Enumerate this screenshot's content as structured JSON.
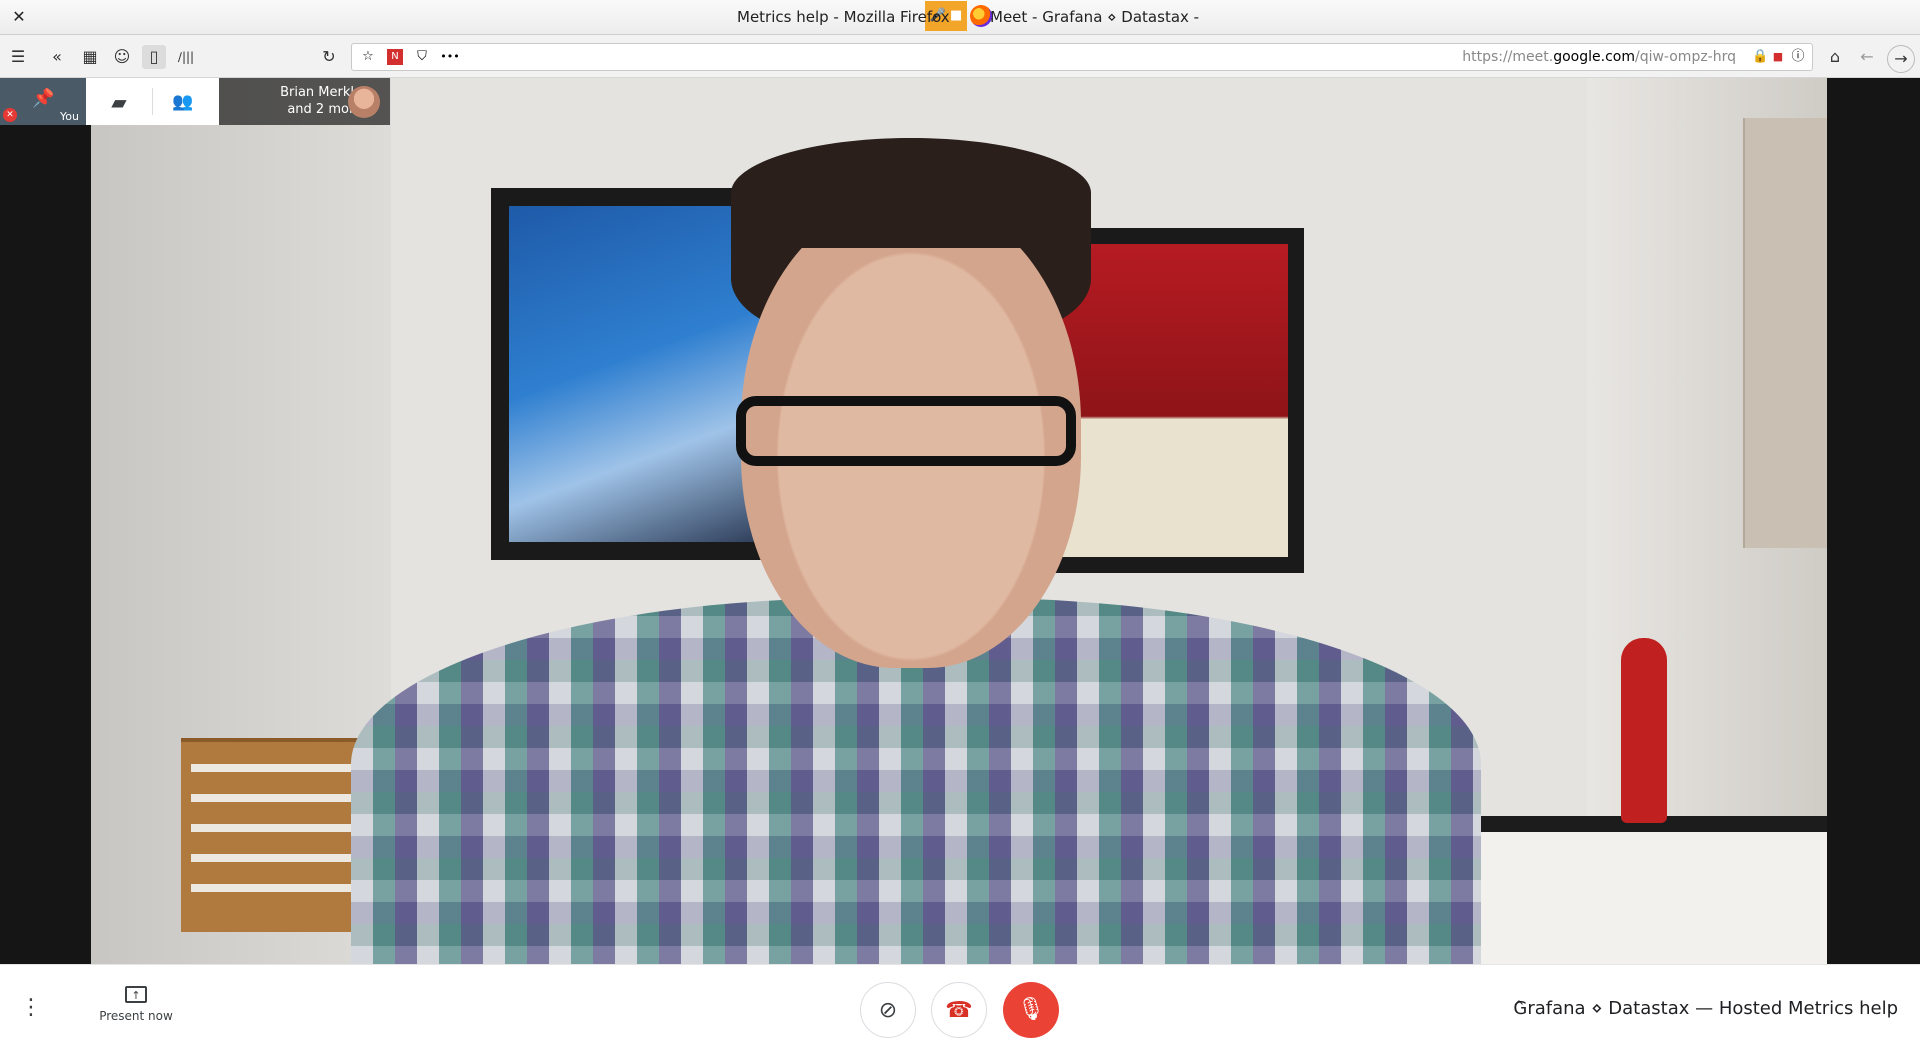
{
  "window": {
    "title_part1": "Meet - Grafana ⋄ Datastax -",
    "title_part2": "Metrics help - Mozilla Firefox",
    "close_glyph": "✕",
    "recording_glyphs": "🎤 ■"
  },
  "toolbar": {
    "menu_glyph": "☰",
    "overflow_glyph": "«",
    "sidebar_glyph": "▦",
    "library_glyph": "∕|||",
    "reload_glyph": "↻",
    "home_glyph": "⌂",
    "back_glyph": "←",
    "forward_glyph": "→"
  },
  "urlbar": {
    "scheme": "https://",
    "subdomain": "meet.",
    "domain": "google.com",
    "path": "/qiw-ompz-hrq",
    "page_actions_glyph": "•••",
    "bookmark_glyph": "☆",
    "info_glyph": "ⓘ"
  },
  "meet": {
    "self_label": "You",
    "participants_line1": "Brian Merkle",
    "participants_line2": "and 2 more",
    "present_label": "Present now",
    "meeting_name": "Grafana ⋄ Datastax — Hosted Metrics help",
    "more_glyph": "⋮",
    "caret_glyph": "^",
    "chat_glyph": "▰",
    "people_glyph": "👥",
    "camera_glyph": "⊘",
    "hangup_glyph": "☎",
    "mic_glyph": "🎙"
  },
  "colors": {
    "mic_off": "#ea4335",
    "hangup": "#d93025",
    "recording": "#f2a528"
  }
}
